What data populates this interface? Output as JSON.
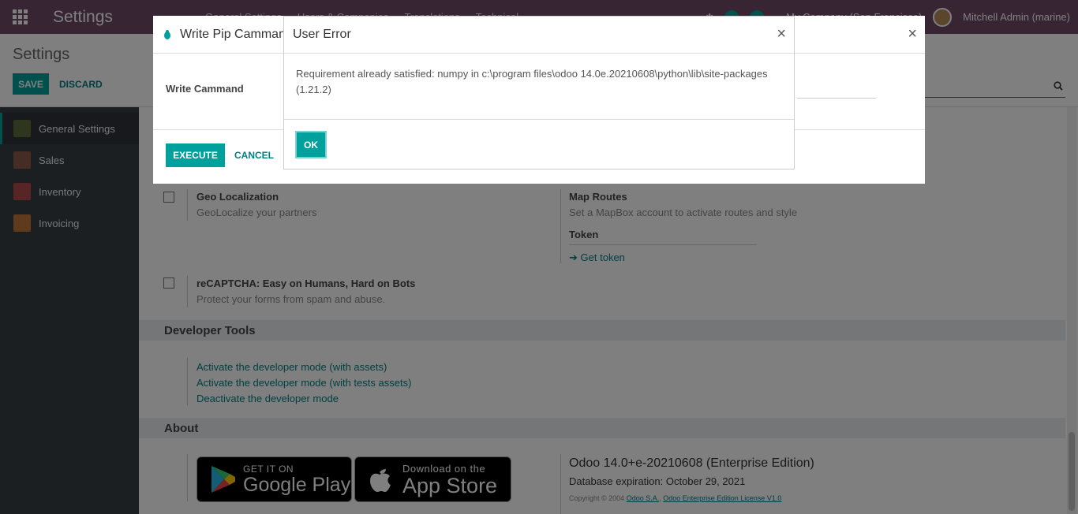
{
  "navbar": {
    "title": "Settings",
    "menu": [
      "General Settings",
      "Users & Companies",
      "Translations",
      "Technical"
    ],
    "badge_count_1": "8",
    "badge_count_2": "8",
    "company": "My Company (San Francisco)",
    "user": "Mitchell Admin (marine)"
  },
  "control_panel": {
    "title": "Settings",
    "save_label": "SAVE",
    "discard_label": "DISCARD"
  },
  "sidebar": {
    "items": [
      {
        "label": "General Settings",
        "icon": "gear-icon",
        "color": "#5d6d3a"
      },
      {
        "label": "Sales",
        "icon": "chart-icon",
        "color": "#8a5a4a"
      },
      {
        "label": "Inventory",
        "icon": "box-icon",
        "color": "#b04a4a"
      },
      {
        "label": "Invoicing",
        "icon": "invoice-icon",
        "color": "#c0743b"
      }
    ]
  },
  "content": {
    "geo": {
      "title": "Geo Localization",
      "desc": "GeoLocalize your partners"
    },
    "map": {
      "title": "Map Routes",
      "desc": "Set a MapBox account to activate routes and style",
      "token_label": "Token",
      "get_token": "Get token"
    },
    "recaptcha": {
      "title": "reCAPTCHA: Easy on Humans, Hard on Bots",
      "desc": "Protect your forms from spam and abuse."
    },
    "dev_tools": {
      "header": "Developer Tools",
      "links": [
        "Activate the developer mode (with assets)",
        "Activate the developer mode (with tests assets)",
        "Deactivate the developer mode"
      ]
    },
    "about": {
      "header": "About",
      "google_small": "GET IT ON",
      "google_big": "Google Play",
      "apple_small": "Download on the",
      "apple_big": "App Store",
      "version": "Odoo 14.0+e-20210608 (Enterprise Edition)",
      "expiration": "Database expiration: October 29, 2021",
      "copyright": "Copyright © 2004",
      "odoo_sa": "Odoo S.A.",
      "license": "Odoo Enterprise Edition License V1.0"
    }
  },
  "back_modal": {
    "title": "Write Pip Cammand",
    "field_label": "Write Cammand",
    "execute_label": "EXECUTE",
    "cancel_label": "CANCEL"
  },
  "front_modal": {
    "title": "User Error",
    "message": "Requirement already satisfied: numpy in c:\\program files\\odoo 14.0e.20210608\\python\\lib\\site-packages (1.21.2)",
    "ok_label": "OK"
  }
}
